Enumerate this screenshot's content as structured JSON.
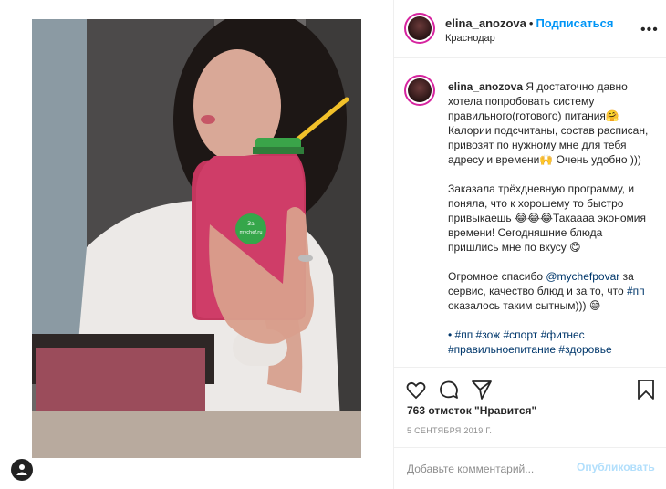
{
  "post": {
    "username": "elina_anozova",
    "follow_label": "Подписаться",
    "location": "Краснодар"
  },
  "photo": {
    "bottle_sticker": "За\nmychef.ru"
  },
  "caption": {
    "username": "elina_anozova",
    "p1": "Я достаточно давно хотела попробовать систему правильного(готового) питания🤗 Калории подсчитаны, состав расписан, привозят по нужному мне для тебя адресу и времени🙌 Очень удобно )))",
    "p2": "Заказала трёхдневную программу, и поняла, что к хорошему то быстро привыкаешь 😂😂😂Такаааа экономия времени! Сегодняшние блюда пришлись мне по вкусу 😋",
    "p3_before": "Огромное спасибо ",
    "p3_mention": "@mychefpovar",
    "p3_middle": " за сервис, качество блюд и за то, что ",
    "p3_tag": "#пп",
    "p3_after": " оказалось таким сытным))) 😅",
    "tags_line1": "• #пп #зож #спорт #фитнес",
    "tags_line2": "#правильноепитание #здоровье"
  },
  "stats": {
    "likes": "763 отметок \"Нравится\"",
    "date": "5 сентября 2019 г."
  },
  "comment": {
    "placeholder": "Добавьте комментарий...",
    "publish_label": "Опубликовать"
  },
  "icons": {
    "like": "heart-icon",
    "comment": "comment-icon",
    "share": "share-icon",
    "save": "bookmark-icon",
    "more": "more-icon"
  },
  "colors": {
    "accent": "#0095f6",
    "publish_disabled": "#b2dffc",
    "avatar_ring": "#d6249f",
    "smoothie": "#c4365e"
  }
}
